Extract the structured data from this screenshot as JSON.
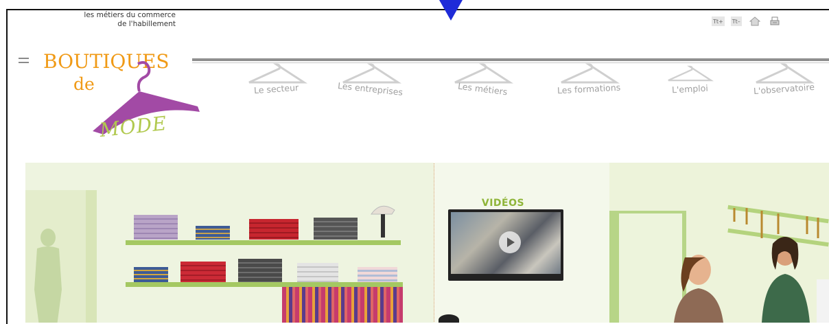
{
  "header": {
    "tagline_line1": "les métiers du commerce",
    "tagline_line2": "de l'habillement",
    "tools": {
      "increase_text": "Tt+",
      "decrease_text": "Tt–"
    },
    "logo": {
      "line1": "BOUTIQUES",
      "line2": "de",
      "line3": "MODE"
    }
  },
  "nav": {
    "items": [
      {
        "label": "Le secteur"
      },
      {
        "label": "Les entreprises"
      },
      {
        "label": "Les métiers"
      },
      {
        "label": "Les formations"
      },
      {
        "label": "L'emploi"
      },
      {
        "label": "L'observatoire"
      }
    ]
  },
  "videos": {
    "title": "VIDÉOS"
  },
  "colors": {
    "brand_orange": "#f09a16",
    "brand_green": "#a4c862",
    "brand_purple": "#a24aa5",
    "pointer_blue": "#1e2bd8"
  }
}
